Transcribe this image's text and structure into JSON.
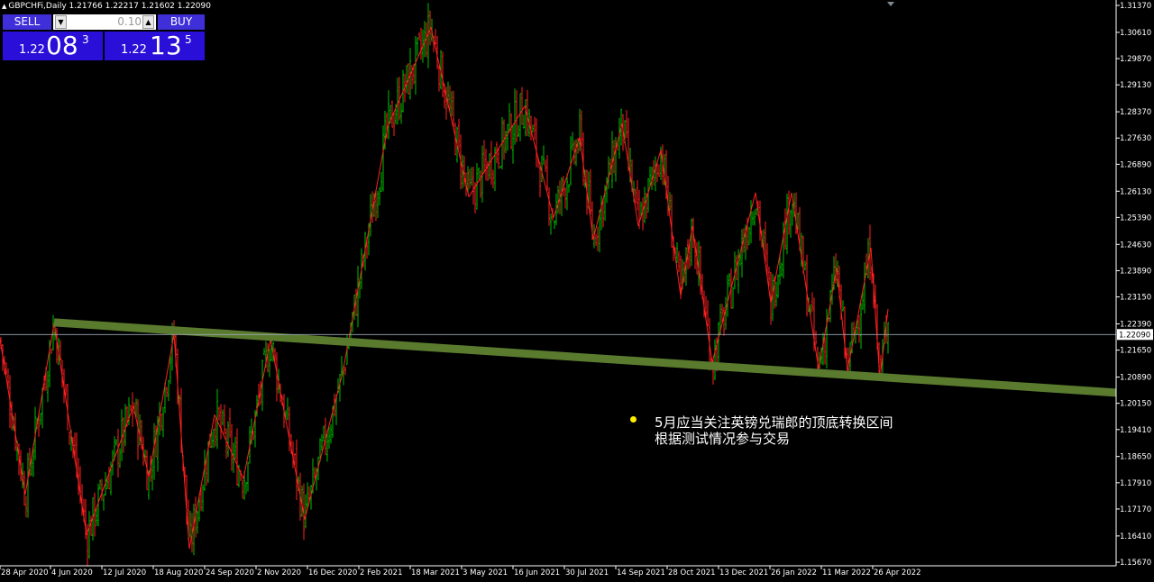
{
  "header": {
    "symbol_line": "GBPCHFi,Daily  1.21766 1.22217 1.21602 1.22090"
  },
  "trade_panel": {
    "sell_label": "SELL",
    "buy_label": "BUY",
    "volume": "0.10",
    "sell_small": "1.22",
    "sell_big": "08",
    "sell_sup": "3",
    "buy_small": "1.22",
    "buy_big": "13",
    "buy_sup": "5"
  },
  "annotation": {
    "line1": "5月应当关注英镑兑瑞郎的顶底转换区间",
    "line2": "根据测试情况参与交易"
  },
  "colors": {
    "background": "#000000",
    "bull": "#00c000",
    "bear": "#ff2020",
    "zigzag": "#ff2020",
    "trendline": "#5a7a2e",
    "axis": "#ffffff",
    "price_line": "#9aa6b2"
  },
  "chart_data": {
    "type": "candlestick",
    "symbol": "GBPCHFi",
    "timeframe": "Daily",
    "ohlc_current": {
      "open": 1.21766,
      "high": 1.22217,
      "low": 1.21602,
      "close": 1.2209
    },
    "current_price": "1.22090",
    "ylim": [
      1.1567,
      1.3137
    ],
    "y_ticks": [
      "1.31370",
      "1.30610",
      "1.29870",
      "1.29130",
      "1.28370",
      "1.27630",
      "1.26890",
      "1.26130",
      "1.25390",
      "1.24630",
      "1.23890",
      "1.23150",
      "1.22390",
      "1.21650",
      "1.20890",
      "1.20150",
      "1.19410",
      "1.18650",
      "1.17910",
      "1.17170",
      "1.16410",
      "1.15670"
    ],
    "x_ticks": [
      "28 Apr 2020",
      "4 Jun 2020",
      "12 Jul 2020",
      "18 Aug 2020",
      "24 Sep 2020",
      "2 Nov 2020",
      "16 Dec 2020",
      "2 Feb 2021",
      "18 Mar 2021",
      "3 May 2021",
      "16 Jun 2021",
      "30 Jul 2021",
      "14 Sep 2021",
      "28 Oct 2021",
      "13 Dec 2021",
      "26 Jan 2022",
      "11 Mar 2022",
      "26 Apr 2022"
    ],
    "zigzag": [
      {
        "x": 0,
        "y": 1.2195
      },
      {
        "x": 28,
        "y": 1.1758
      },
      {
        "x": 60,
        "y": 1.2241
      },
      {
        "x": 96,
        "y": 1.1644
      },
      {
        "x": 148,
        "y": 1.2007
      },
      {
        "x": 165,
        "y": 1.1808
      },
      {
        "x": 193,
        "y": 1.221
      },
      {
        "x": 210,
        "y": 1.1605
      },
      {
        "x": 238,
        "y": 1.1983
      },
      {
        "x": 270,
        "y": 1.1802
      },
      {
        "x": 300,
        "y": 1.2195
      },
      {
        "x": 338,
        "y": 1.1688
      },
      {
        "x": 380,
        "y": 1.21
      },
      {
        "x": 430,
        "y": 1.2795
      },
      {
        "x": 478,
        "y": 1.3075
      },
      {
        "x": 520,
        "y": 1.2597
      },
      {
        "x": 582,
        "y": 1.2853
      },
      {
        "x": 614,
        "y": 1.2539
      },
      {
        "x": 643,
        "y": 1.2766
      },
      {
        "x": 658,
        "y": 1.2478
      },
      {
        "x": 690,
        "y": 1.2803
      },
      {
        "x": 708,
        "y": 1.2515
      },
      {
        "x": 733,
        "y": 1.2729
      },
      {
        "x": 755,
        "y": 1.2318
      },
      {
        "x": 768,
        "y": 1.2514
      },
      {
        "x": 790,
        "y": 1.213
      },
      {
        "x": 838,
        "y": 1.2609
      },
      {
        "x": 855,
        "y": 1.2298
      },
      {
        "x": 878,
        "y": 1.2609
      },
      {
        "x": 908,
        "y": 1.2112
      },
      {
        "x": 928,
        "y": 1.2396
      },
      {
        "x": 940,
        "y": 1.2107
      },
      {
        "x": 966,
        "y": 1.2453
      },
      {
        "x": 976,
        "y": 1.2082
      },
      {
        "x": 985,
        "y": 1.2281
      }
    ],
    "trendline": [
      {
        "x": 60,
        "y": 1.2243
      },
      {
        "x": 1238,
        "y": 1.2045
      }
    ]
  }
}
